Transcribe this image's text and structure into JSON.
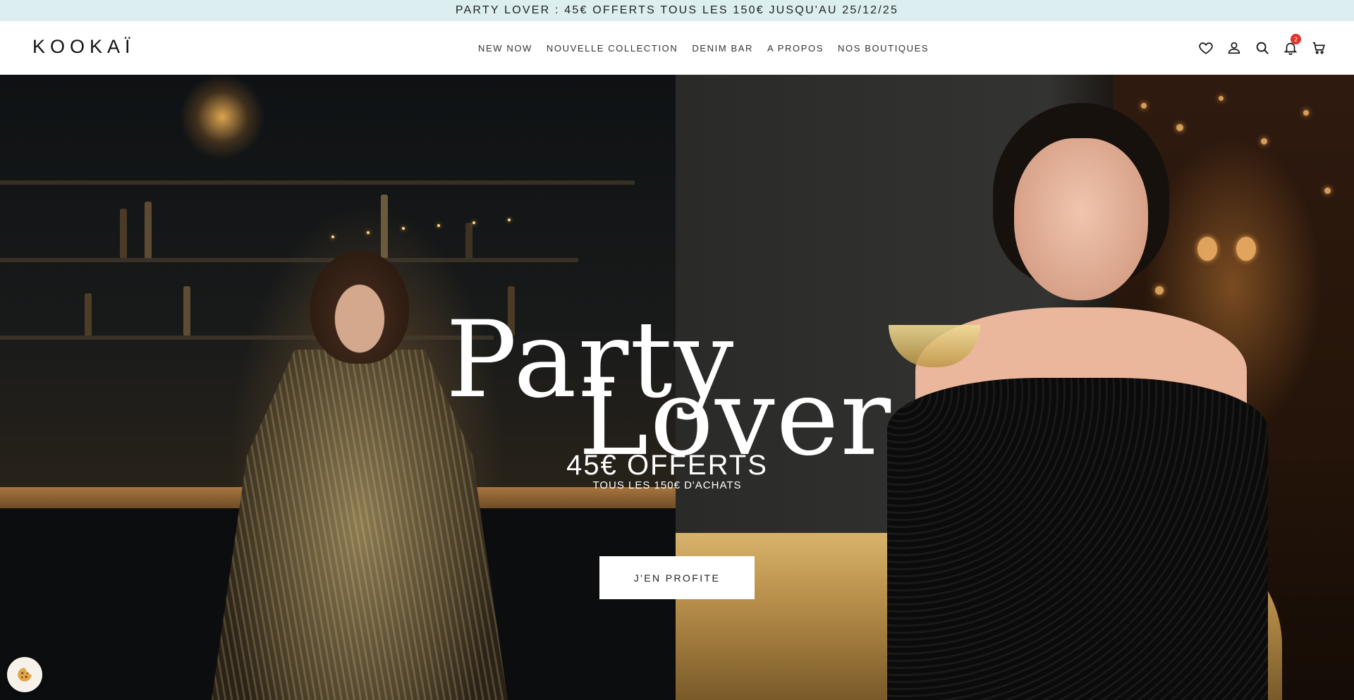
{
  "promo": {
    "text": "PARTY LOVER : 45€ OFFERTS TOUS LES 150€ JUSQU'AU 25/12/25"
  },
  "header": {
    "logo": "KOOKAÏ",
    "nav": [
      {
        "label": "NEW NOW"
      },
      {
        "label": "NOUVELLE COLLECTION"
      },
      {
        "label": "DENIM BAR"
      },
      {
        "label": "A PROPOS"
      },
      {
        "label": "NOS BOUTIQUES"
      }
    ],
    "icons": {
      "wishlist": "heart-icon",
      "account": "user-icon",
      "search": "search-icon",
      "notifications": "bell-icon",
      "cart": "cart-icon"
    },
    "notification_count": "2",
    "badge_color": "#e1312a"
  },
  "hero": {
    "title_line1": "Party",
    "title_line2": "Lover",
    "offer": "45€ OFFERTS",
    "offer_sub": "TOUS LES 150€ D'ACHATS",
    "cta_label": "J'EN PROFITE"
  },
  "cookie": {
    "icon": "cookie-icon"
  },
  "colors": {
    "promo_bg": "#dceef0",
    "header_bg": "#ffffff"
  }
}
